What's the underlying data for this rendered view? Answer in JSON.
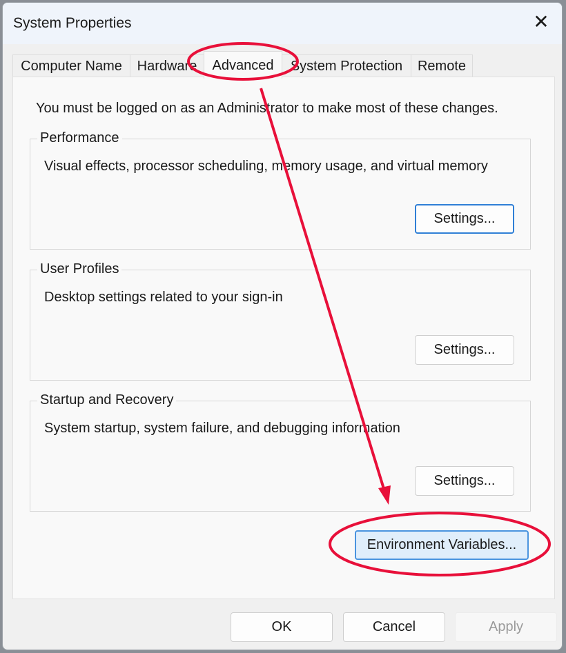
{
  "window": {
    "title": "System Properties",
    "close_icon": "close-icon"
  },
  "tabs": [
    {
      "label": "Computer Name"
    },
    {
      "label": "Hardware"
    },
    {
      "label": "Advanced",
      "active": true
    },
    {
      "label": "System Protection"
    },
    {
      "label": "Remote"
    }
  ],
  "admin_notice": "You must be logged on as an Administrator to make most of these changes.",
  "groups": [
    {
      "label": "Performance",
      "description": "Visual effects, processor scheduling, memory usage, and virtual memory",
      "button": "Settings..."
    },
    {
      "label": "User Profiles",
      "description": "Desktop settings related to your sign-in",
      "button": "Settings..."
    },
    {
      "label": "Startup and Recovery",
      "description": "System startup, system failure, and debugging information",
      "button": "Settings..."
    }
  ],
  "env_button": "Environment Variables...",
  "footer": {
    "ok": "OK",
    "cancel": "Cancel",
    "apply": "Apply"
  },
  "annotation_color": "#e8103a"
}
